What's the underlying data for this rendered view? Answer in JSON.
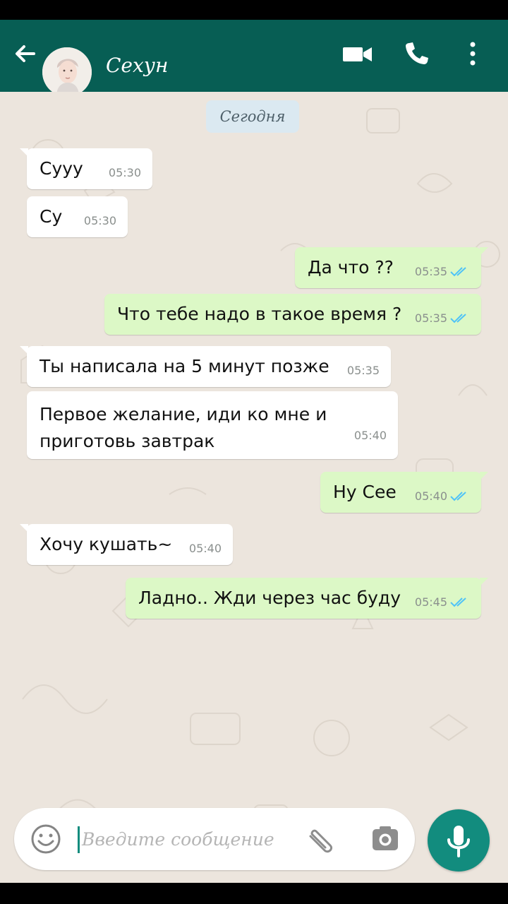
{
  "header": {
    "contact_name": "Сехун",
    "icons": [
      "back-arrow-icon",
      "avatar",
      "video-call-icon",
      "phone-icon",
      "more-vert-icon"
    ]
  },
  "chat": {
    "date_label": "Сегодня",
    "messages": [
      {
        "direction": "in",
        "text": "Сууу",
        "time": "05:30"
      },
      {
        "direction": "in",
        "text": "Су",
        "time": "05:30"
      },
      {
        "direction": "out",
        "text": "Да что ??",
        "time": "05:35",
        "status": "read"
      },
      {
        "direction": "out",
        "text": "Что тебе надо в такое время ?",
        "time": "05:35",
        "status": "read"
      },
      {
        "direction": "in",
        "text": "Ты написала на 5 минут позже",
        "time": "05:35"
      },
      {
        "direction": "in",
        "text": "Первое желание, иди ко мне и приготовь завтрак",
        "time": "05:40"
      },
      {
        "direction": "out",
        "text": "Ну Сее",
        "time": "05:40",
        "status": "read"
      },
      {
        "direction": "in",
        "text": "Хочу кушать~",
        "time": "05:40"
      },
      {
        "direction": "out",
        "text": "Ладно.. Жди через час буду",
        "time": "05:45",
        "status": "read"
      }
    ]
  },
  "composer": {
    "placeholder": "Введите сообщение",
    "icons": [
      "emoji-icon",
      "attach-icon",
      "camera-icon",
      "mic-icon"
    ]
  },
  "colors": {
    "header": "#075e54",
    "accent": "#128c7e",
    "incoming_bubble": "#ffffff",
    "outgoing_bubble": "#dcf8c6",
    "chat_bg": "#ece5dd",
    "read_ticks": "#4fc3f7"
  }
}
